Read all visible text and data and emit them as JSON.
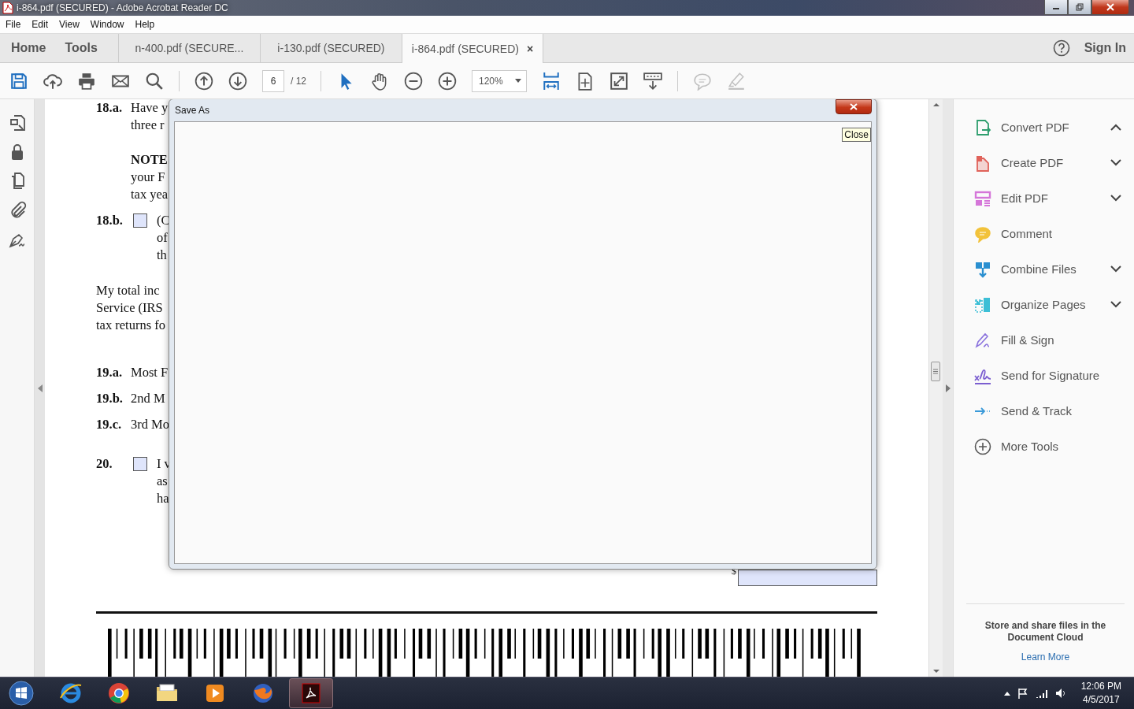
{
  "window": {
    "title": "i-864.pdf (SECURED) - Adobe Acrobat Reader DC"
  },
  "menu": [
    "File",
    "Edit",
    "View",
    "Window",
    "Help"
  ],
  "nav": [
    "Home",
    "Tools"
  ],
  "tabs": [
    {
      "label": "n-400.pdf (SECURE...",
      "selected": false
    },
    {
      "label": "i-130.pdf (SECURED)",
      "selected": false
    },
    {
      "label": "i-864.pdf (SECURED)",
      "selected": true,
      "close": "×"
    }
  ],
  "sign_in": "Sign In",
  "toolbar": {
    "page": "6",
    "page_count": "/ 12",
    "zoom": "120%",
    "buttons": [
      {
        "disabled": false
      },
      {
        "disabled": false
      },
      {
        "disabled": false
      },
      {
        "disabled": false
      },
      {
        "disabled": false
      },
      {
        "disabled": false
      },
      {
        "disabled": false
      },
      {
        "disabled": false
      },
      {
        "disabled": false
      },
      {
        "disabled": false
      },
      {
        "disabled": false
      },
      {
        "disabled": false
      },
      {
        "disabled": false
      },
      {
        "disabled": false
      },
      {
        "disabled": false
      },
      {
        "disabled": true
      },
      {
        "disabled": true
      }
    ]
  },
  "document": {
    "blocks": [
      {
        "number": "18.a.",
        "lines": [
          "Have y",
          "three r"
        ]
      },
      {
        "lines": [
          "**NOTE**",
          "your F",
          "tax yea"
        ]
      },
      {
        "number": "18.b.",
        "checkbox": {
          "checked": false
        },
        "lines": [
          "(C",
          "of",
          "th"
        ]
      },
      {
        "lines": [
          "My total inc",
          "Service (IRS",
          "tax returns fo"
        ]
      },
      {
        "number": "19.a.",
        "lines": [
          "Most F"
        ]
      },
      {
        "number": "19.b.",
        "lines": [
          "2nd M"
        ]
      },
      {
        "number": "19.c.",
        "lines": [
          "3rd Mo"
        ]
      },
      {
        "number": "20.",
        "checkbox": {
          "checked": false
        },
        "lines": [
          "I v",
          "as",
          "ha"
        ]
      }
    ],
    "currency": "$"
  },
  "dialog": {
    "title": "Save As",
    "tooltip": "Close"
  },
  "tools": [
    {
      "label": "Convert PDF",
      "color": "#2e9e6e",
      "expanded": true
    },
    {
      "label": "Create PDF",
      "color": "#e0625a",
      "expanded": false
    },
    {
      "label": "Edit PDF",
      "color": "#d576d9",
      "expanded": false
    },
    {
      "label": "Comment",
      "color": "#f2c23a"
    },
    {
      "label": "Combine Files",
      "color": "#2a8fd0",
      "expanded": false
    },
    {
      "label": "Organize Pages",
      "color": "#3cbfd6",
      "expanded": false
    },
    {
      "label": "Fill & Sign",
      "color": "#8a72dd"
    },
    {
      "label": "Send for Signature",
      "color": "#7b5ed0"
    },
    {
      "label": "Send & Track",
      "color": "#3a9ad9"
    },
    {
      "label": "More Tools",
      "color": "#555555"
    }
  ],
  "cloud": {
    "text": "Store and share files in the Document Cloud",
    "link": "Learn More"
  },
  "taskbar": {
    "apps": [
      {
        "selected": false
      },
      {
        "selected": false
      },
      {
        "selected": false
      },
      {
        "selected": false
      },
      {
        "selected": false
      },
      {
        "selected": true
      }
    ],
    "time": "12:06 PM",
    "date": "4/5/2017"
  }
}
